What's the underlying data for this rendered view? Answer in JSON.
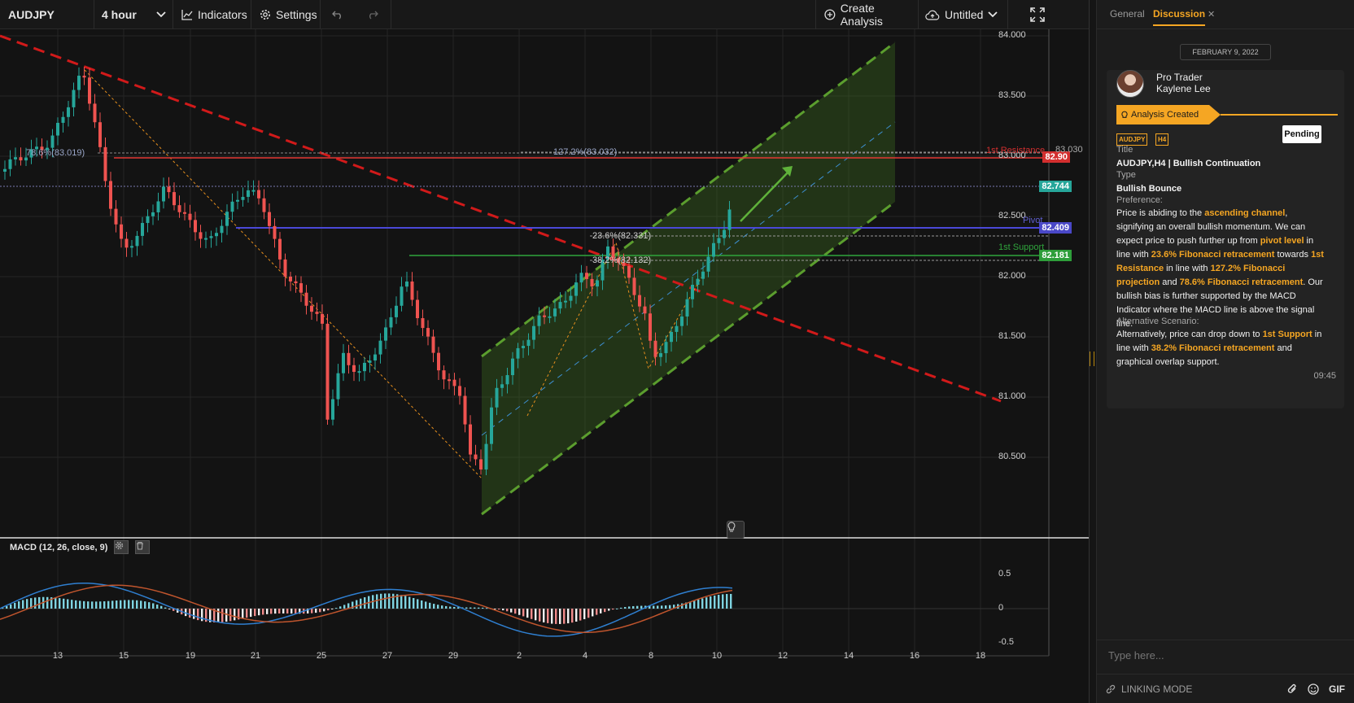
{
  "toolbar": {
    "symbol": "AUDJPY",
    "interval": "4 hour",
    "indicators_label": "Indicators",
    "settings_label": "Settings",
    "create_analysis_label": "Create Analysis",
    "untitled_label": "Untitled"
  },
  "price_axis": {
    "ticks": [
      "84.000",
      "83.500",
      "83.000",
      "82.500",
      "82.000",
      "81.500",
      "81.000",
      "80.500"
    ],
    "tags": {
      "resistance": "82.90",
      "current": "82.744",
      "pivot": "82.409",
      "support": "82.181",
      "fib_projection_right": "83.030"
    },
    "colors": {
      "resistance": "#d32f2f",
      "current": "#26a69a",
      "pivot": "#3d3bbf",
      "support": "#2e9e3a"
    }
  },
  "date_axis": [
    "13",
    "15",
    "19",
    "21",
    "25",
    "27",
    "29",
    "2",
    "4",
    "8",
    "10",
    "12",
    "14",
    "16",
    "18"
  ],
  "levels": {
    "fib_786": "78.6%(83.019)",
    "fib_1272": "127.2%(83.032)",
    "fib_236": "23.6%(82.331)",
    "fib_382": "38.2%(82.132)",
    "resistance_label": "1st Resistance",
    "pivot_label": "Pivot",
    "support_label": "1st Support"
  },
  "macd": {
    "title": "MACD (12, 26, close, 9)",
    "ticks": [
      "0.5",
      "0",
      "-0.5"
    ]
  },
  "panel": {
    "tabs": [
      "General",
      "Discussion"
    ],
    "close_glyph": "✕",
    "date": "FEBRUARY 9, 2022",
    "author_role": "Pro Trader",
    "author_name": "Kaylene Lee",
    "analysis_created": "Analysis Created",
    "tag_symbol": "AUDJPY",
    "tag_interval": "H4",
    "status": "Pending",
    "title_label": "Title",
    "title_value": "AUDJPY,H4 | Bullish Continuation",
    "type_label": "Type",
    "type_value": "Bullish Bounce",
    "preference_label": "Preference:",
    "preference_text": [
      {
        "t": "Price is abiding to the ",
        "h": false
      },
      {
        "t": "ascending channel",
        "h": true
      },
      {
        "t": ", signifying an overall bullish momentum. We can expect price to push further up from ",
        "h": false
      },
      {
        "t": "pivot level",
        "h": true
      },
      {
        "t": " in line with ",
        "h": false
      },
      {
        "t": "23.6% Fibonacci retracement",
        "h": true
      },
      {
        "t": " towards ",
        "h": false
      },
      {
        "t": "1st Resistance",
        "h": true
      },
      {
        "t": " in line with ",
        "h": false
      },
      {
        "t": "127.2% Fibonacci projection",
        "h": true
      },
      {
        "t": " and ",
        "h": false
      },
      {
        "t": "78.6% Fibonacci retracement",
        "h": true
      },
      {
        "t": ". Our bullish bias is further supported by the MACD Indicator where the MACD line is above the signal line.",
        "h": false
      }
    ],
    "alternative_label": "Alternative Scenario:",
    "alternative_text": [
      {
        "t": "Alternatively, price can drop down to ",
        "h": false
      },
      {
        "t": "1st Support",
        "h": true
      },
      {
        "t": " in line with ",
        "h": false
      },
      {
        "t": "38.2% Fibonacci retracement",
        "h": true
      },
      {
        "t": " and graphical overlap support.",
        "h": false
      }
    ],
    "time": "09:45",
    "input_placeholder": "Type here...",
    "linking_mode": "LINKING MODE",
    "gif_label": "GIF"
  },
  "colors": {
    "accent": "#f5a623",
    "channel": "#4c8a2a",
    "trend": "#d32f2f"
  }
}
